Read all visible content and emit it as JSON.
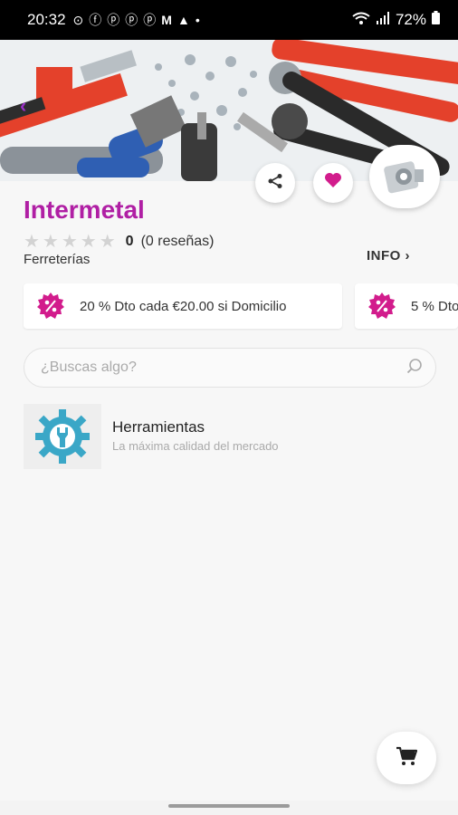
{
  "status_bar": {
    "time": "20:32",
    "battery": "72%"
  },
  "store": {
    "name": "Intermetal",
    "rating_count": "0",
    "reviews": "(0 reseñas)",
    "category": "Ferreterías",
    "info_label": "INFO ›"
  },
  "promos": [
    {
      "text": "20 % Dto cada €20.00 si Domicilio"
    },
    {
      "text": "5 % Dto"
    }
  ],
  "search": {
    "placeholder": "¿Buscas algo?"
  },
  "products": [
    {
      "title": "Herramientas",
      "subtitle": "La máxima calidad del mercado"
    }
  ],
  "colors": {
    "brand": "#b01fa4",
    "heart": "#d21c8c",
    "badge": "#d21c8c",
    "gear_icon": "#3aa7c7"
  },
  "icons": [
    "back-arrow-icon",
    "share-icon",
    "heart-icon",
    "store-logo",
    "percent-badge-icon",
    "search-icon",
    "gear-wrench-icon",
    "cart-icon"
  ]
}
